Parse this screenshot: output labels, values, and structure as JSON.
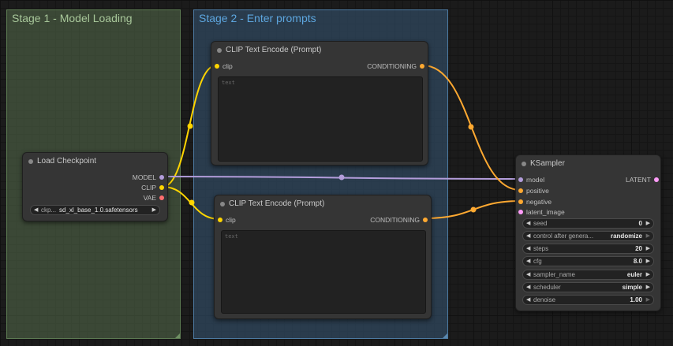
{
  "colors": {
    "clip_wire": "#ffd500",
    "conditioning_wire": "#ffa931",
    "model_wire": "#b39ddb",
    "model_pin": "#b39ddb",
    "clip_pin": "#ffd500",
    "vae_pin": "#ff6e6e",
    "conditioning_pin": "#ffa931",
    "latent_pin": "#ff9cf9"
  },
  "groups": {
    "stage1": "Stage 1 - Model Loading",
    "stage2": "Stage 2 - Enter prompts"
  },
  "load_checkpoint": {
    "title": "Load Checkpoint",
    "outputs": [
      "MODEL",
      "CLIP",
      "VAE"
    ],
    "ckpt_label": "ckp...",
    "ckpt_value": "sd_xl_base_1.0.safetensors"
  },
  "clip_top": {
    "title": "CLIP Text Encode (Prompt)",
    "input": "clip",
    "output": "CONDITIONING",
    "placeholder": "text"
  },
  "clip_bottom": {
    "title": "CLIP Text Encode (Prompt)",
    "input": "clip",
    "output": "CONDITIONING",
    "placeholder": "text"
  },
  "ksampler": {
    "title": "KSampler",
    "inputs": [
      "model",
      "positive",
      "negative",
      "latent_image"
    ],
    "output": "LATENT",
    "widgets": [
      {
        "label": "seed",
        "value": "0"
      },
      {
        "label": "control after genera...",
        "value": "randomize"
      },
      {
        "label": "steps",
        "value": "20"
      },
      {
        "label": "cfg",
        "value": "8.0"
      },
      {
        "label": "sampler_name",
        "value": "euler"
      },
      {
        "label": "scheduler",
        "value": "simple"
      },
      {
        "label": "denoise",
        "value": "1.00"
      }
    ]
  }
}
